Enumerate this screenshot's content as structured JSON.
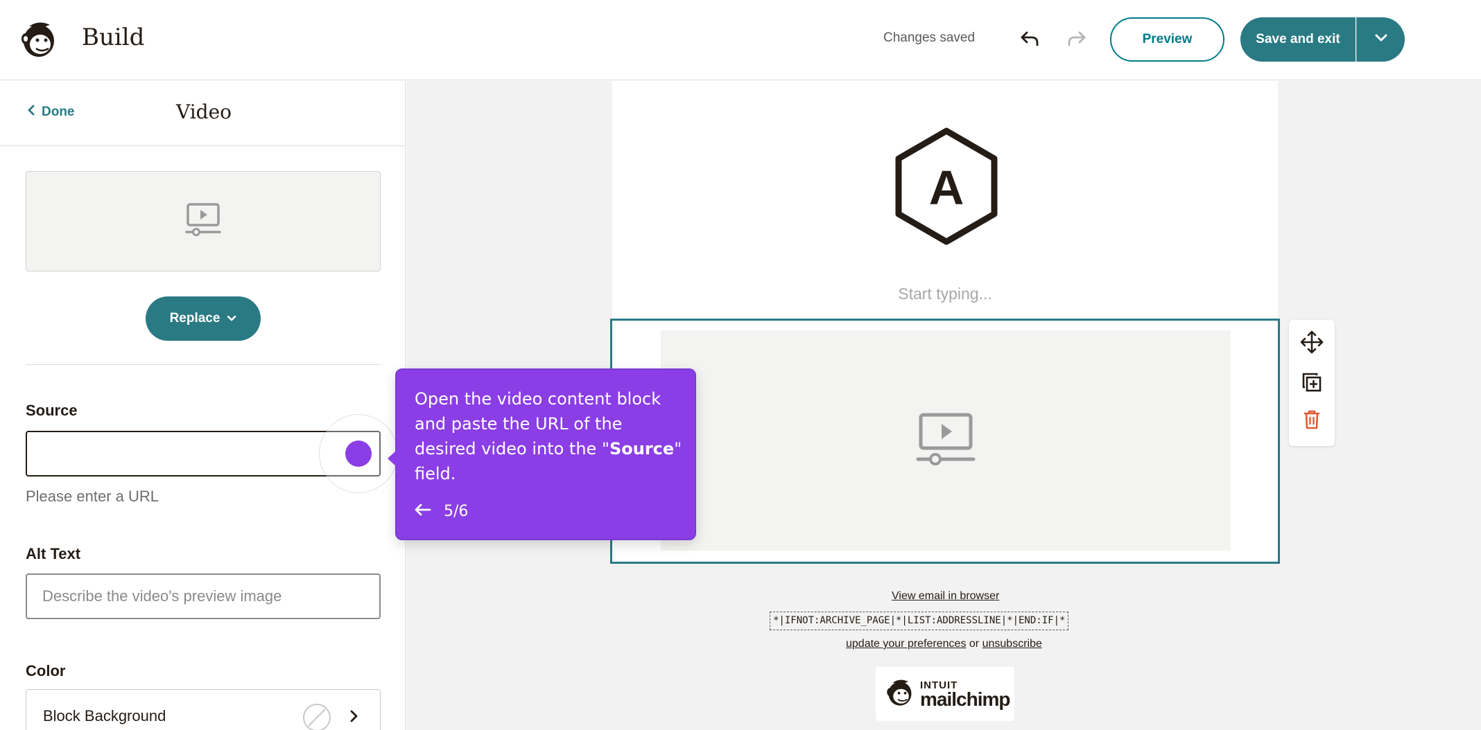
{
  "header": {
    "title": "Build",
    "save_status": "Changes saved",
    "preview_label": "Preview",
    "save_exit_label": "Save and exit",
    "colors": {
      "primary": "#2a7a84",
      "outline": "#007c89"
    }
  },
  "panel": {
    "back_label": "Done",
    "title": "Video",
    "replace_label": "Replace",
    "source": {
      "label": "Source",
      "value": "",
      "helper": "Please enter a URL"
    },
    "alt_text": {
      "label": "Alt Text",
      "placeholder": "Describe the video's preview image"
    },
    "color": {
      "label": "Color",
      "row_label": "Block Background"
    }
  },
  "canvas": {
    "logo_letter": "A",
    "start_typing": "Start typing...",
    "footer": {
      "view_in_browser": "View email in browser",
      "merge_tags": "*|IFNOT:ARCHIVE_PAGE|*|LIST:ADDRESSLINE|*|END:IF|*",
      "update_preferences": "update your preferences",
      "or_text": "or",
      "unsubscribe": "unsubscribe",
      "badge_line1": "INTUIT",
      "badge_line2": "mailchimp"
    },
    "colors": {
      "selected_border": "#2a7a84",
      "delete": "#e05b34"
    }
  },
  "guide": {
    "text_before": "Open the video content block and paste the URL of the desired video into the \"",
    "text_bold": "Source",
    "text_after": "\" field.",
    "step": "5/6",
    "color": "#8b3ee6"
  }
}
